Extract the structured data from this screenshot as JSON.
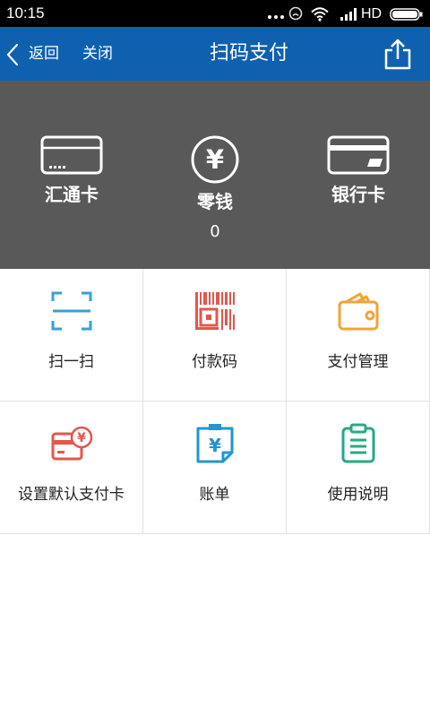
{
  "currency_symbol": "¥",
  "status_bar": {
    "time": "10:15",
    "network_type": "HD",
    "icons": [
      "more-dots-icon",
      "alarm-icon",
      "wifi-icon",
      "signal-icon",
      "battery-icon"
    ],
    "background": "#000000"
  },
  "header": {
    "back_icon": "chevron-left-icon",
    "back_label": "返回",
    "close_label": "关闭",
    "title": "扫码支付",
    "share_icon": "share-icon",
    "background": "#1060b0"
  },
  "balance_panel": {
    "background": "#595959",
    "items": [
      {
        "label": "汇通卡",
        "icon": "card-icon"
      },
      {
        "label": "零钱",
        "value": "0",
        "icon": "yen-circle-icon"
      },
      {
        "label": "银行卡",
        "icon": "bank-card-icon"
      }
    ]
  },
  "grid": {
    "items": [
      {
        "label": "扫一扫",
        "icon": "scan-icon",
        "color": "#3a9fd6"
      },
      {
        "label": "付款码",
        "icon": "barcode-icon",
        "color": "#e2574c"
      },
      {
        "label": "支付管理",
        "icon": "wallet-icon",
        "color": "#f2a33a"
      },
      {
        "label": "设置默认支付卡",
        "icon": "card-yen-badge-icon",
        "color": "#e2574c"
      },
      {
        "label": "账单",
        "icon": "bill-icon",
        "color": "#2196d3"
      },
      {
        "label": "使用说明",
        "icon": "instructions-icon",
        "color": "#27a985"
      }
    ]
  }
}
